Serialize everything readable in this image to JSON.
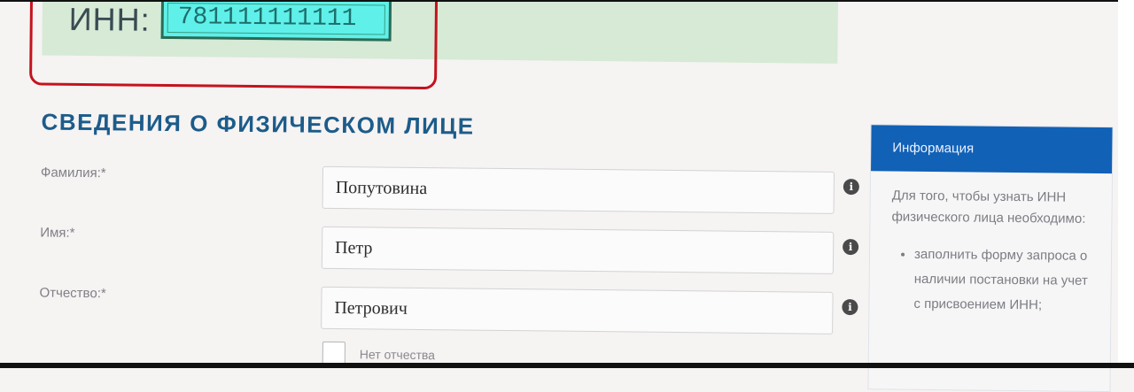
{
  "result": {
    "inn_label": "ИНН:",
    "inn_value": "781111111111"
  },
  "section": {
    "title": "СВЕДЕНИЯ О ФИЗИЧЕСКОМ ЛИЦЕ"
  },
  "form": {
    "fields": [
      {
        "label": "Фамилия:*",
        "value": "Попутовина"
      },
      {
        "label": "Имя:*",
        "value": "Петр"
      },
      {
        "label": "Отчество:*",
        "value": "Петрович"
      }
    ],
    "no_patronymic_label": "Нет отчества",
    "info_icon": "info-icon"
  },
  "sidebar": {
    "header": "Информация",
    "intro": "Для того, чтобы узнать ИНН физического лица необходимо:",
    "bullets": [
      "заполнить форму запроса о наличии постановки на учет с присвоением ИНН;"
    ]
  },
  "colors": {
    "accent_blue": "#1161b6",
    "title_blue": "#1c5c8a",
    "highlight_red": "#c4131d",
    "inn_bg": "#5ff0ea",
    "result_bg": "#d6ead6"
  }
}
